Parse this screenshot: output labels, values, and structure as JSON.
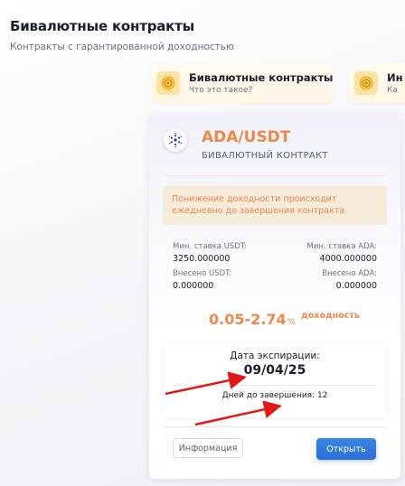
{
  "header": {
    "title": "Бивалютные контракты",
    "subtitle": "Контракты с гарантированной доходностью"
  },
  "info_cards": [
    {
      "title": "Бивалютные контракты",
      "subtitle": "Что это такое?",
      "icon": "coin-icon"
    },
    {
      "title": "Ин",
      "subtitle": "Ка",
      "icon": "coin-icon"
    }
  ],
  "contract": {
    "pair": "ADA/USDT",
    "type": "БИВАЛЮТНЫЙ КОНТРАКТ",
    "warning": "Понижение доходности происходит ежедневно до завершения контракта",
    "min_rate_usdt_label": "Мин. ставка USDT:",
    "min_rate_usdt_value": "3250.000000",
    "min_rate_ada_label": "Мин. ставка ADA:",
    "min_rate_ada_value": "4000.000000",
    "deposited_usdt_label": "Внесено USDT:",
    "deposited_usdt_value": "0.000000",
    "deposited_ada_label": "Внесено ADA:",
    "deposited_ada_value": "0.000000",
    "yield_value": "0.05-2.74",
    "yield_unit": "%",
    "yield_label": "доходность",
    "expiry_label": "Дата экспирации:",
    "expiry_date": "09/04/25",
    "days_label": "Дней до завершения: 12",
    "info_button": "Информация",
    "open_button": "Открыть"
  },
  "colors": {
    "accent": "#f0874a",
    "primary_button": "#2a6fd6",
    "annotation_arrow": "#e01818"
  }
}
